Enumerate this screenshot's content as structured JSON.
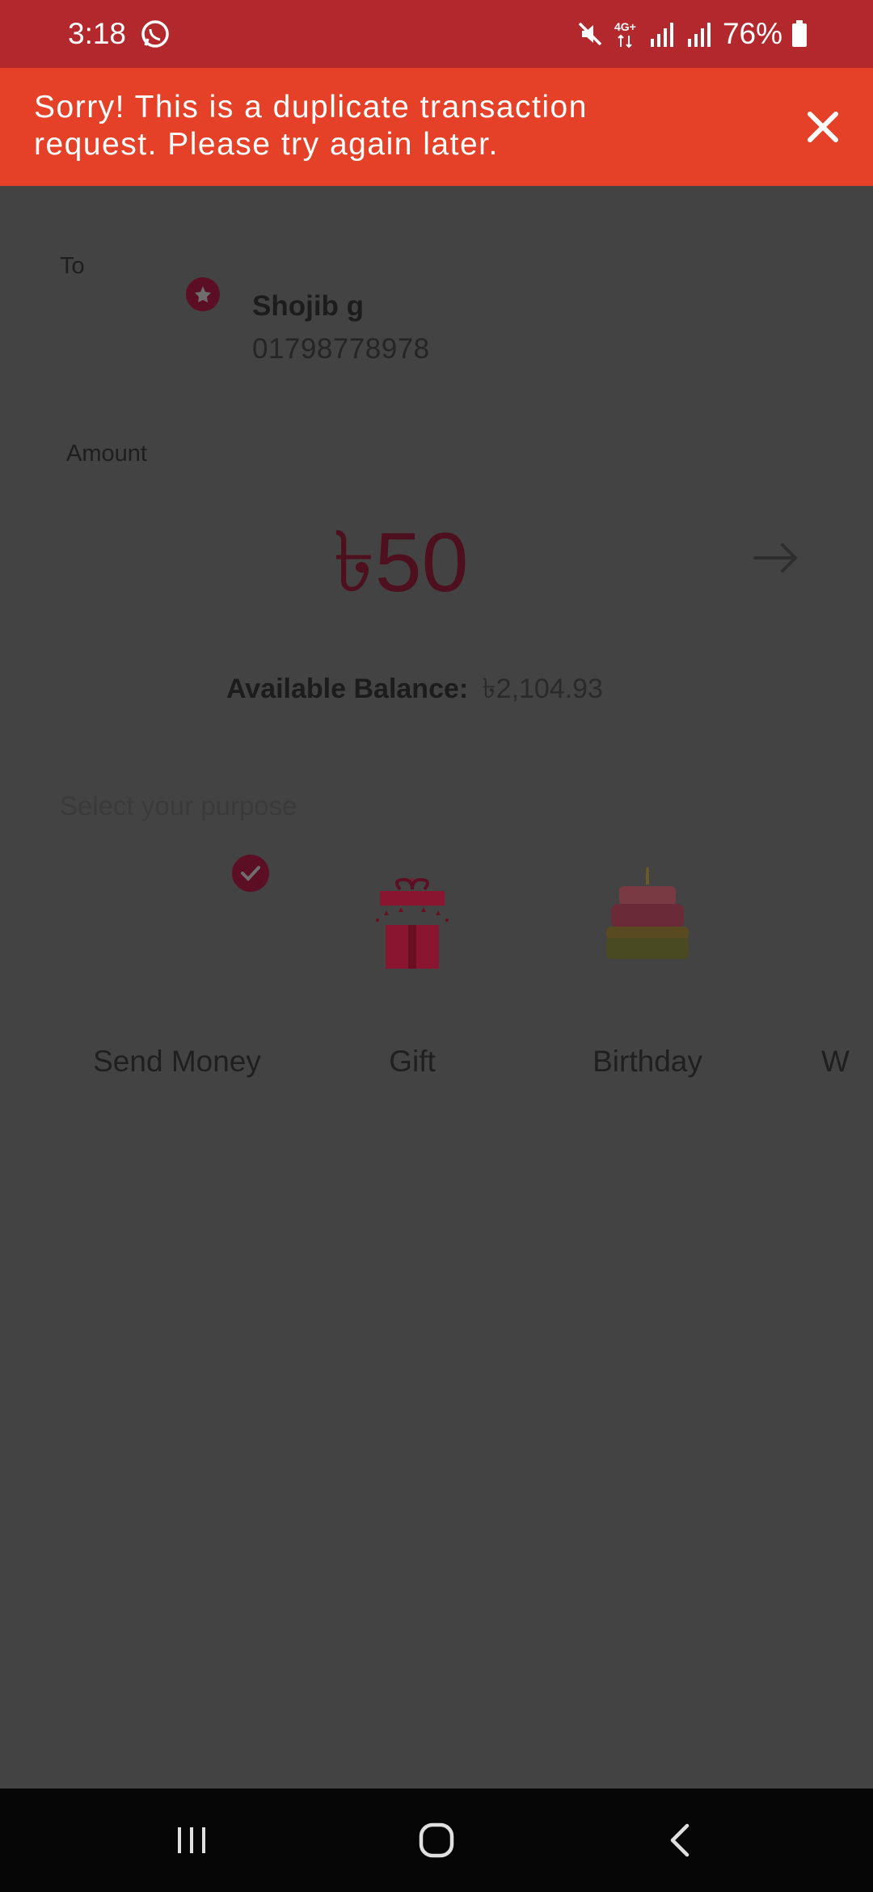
{
  "status_bar": {
    "time": "3:18",
    "network": "4G+",
    "battery": "76%",
    "icons": [
      "whatsapp-icon",
      "mute-icon",
      "signal-icon",
      "signal-icon",
      "battery-icon"
    ]
  },
  "error_banner": {
    "message": "Sorry! This is a duplicate transaction request. Please try again later.",
    "background": "#e54128"
  },
  "recipient": {
    "label": "To",
    "name": "Shojib g",
    "phone": "01798778978"
  },
  "amount": {
    "label": "Amount",
    "value": "৳50"
  },
  "balance": {
    "label": "Available Balance:",
    "value": "৳2,104.93"
  },
  "purpose": {
    "label": "Select your purpose",
    "items": [
      {
        "label": "Send Money",
        "icon": "send-money-icon",
        "selected": true
      },
      {
        "label": "Gift",
        "icon": "gift-icon",
        "selected": false
      },
      {
        "label": "Birthday",
        "icon": "birthday-cake-icon",
        "selected": false
      },
      {
        "label": "W",
        "icon": "partial-icon",
        "selected": false
      }
    ]
  },
  "colors": {
    "status_bar": "#b3282d",
    "overlay_background": "#434343",
    "brand": "#5c0f24"
  }
}
